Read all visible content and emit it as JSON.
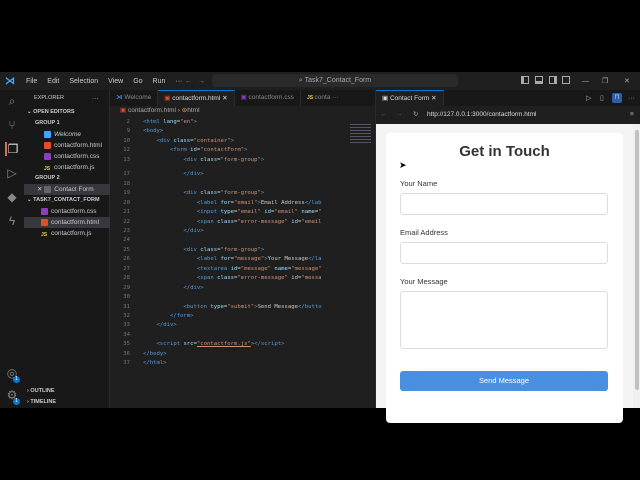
{
  "titlebar": {
    "menus": [
      "File",
      "Edit",
      "Selection",
      "View",
      "Go",
      "Run",
      "···"
    ],
    "command_center": "Task7_Contact_Form"
  },
  "sidebar": {
    "title": "EXPLORER",
    "open_editors": "OPEN EDITORS",
    "group1": "GROUP 1",
    "group1_items": [
      "Welcome",
      "contactform.html",
      "contactform.css",
      "contactform.js"
    ],
    "group2": "GROUP 2",
    "group2_items": [
      "Contact Form"
    ],
    "folder": "TASK7_CONTACT_FORM",
    "folder_items": [
      "contactform.css",
      "contactform.html",
      "contactform.js"
    ],
    "outline": "OUTLINE",
    "timeline": "TIMELINE",
    "badge": "1"
  },
  "editor": {
    "tabs": [
      "Welcome",
      "contactform.html",
      "contactform.css",
      "conta"
    ],
    "breadcrumb": [
      "contactform.html",
      "html"
    ],
    "lines": [
      [
        "2",
        [
          [
            "t",
            "<html "
          ],
          [
            "a",
            "lang"
          ],
          [
            "x",
            "="
          ],
          [
            "s",
            "\"en\""
          ],
          [
            "t",
            ">"
          ]
        ]
      ],
      [
        "9",
        [
          [
            "t",
            "<body>"
          ]
        ]
      ],
      [
        "10",
        [
          [
            "x",
            "    "
          ],
          [
            "t",
            "<div "
          ],
          [
            "a",
            "class"
          ],
          [
            "x",
            "="
          ],
          [
            "s",
            "\"container\""
          ],
          [
            "t",
            ">"
          ]
        ]
      ],
      [
        "12",
        [
          [
            "x",
            "        "
          ],
          [
            "t",
            "<form "
          ],
          [
            "a",
            "id"
          ],
          [
            "x",
            "="
          ],
          [
            "s",
            "\"contactForm\""
          ],
          [
            "t",
            ">"
          ]
        ]
      ],
      [
        "13",
        [
          [
            "x",
            "            "
          ],
          [
            "t",
            "<div "
          ],
          [
            "a",
            "class"
          ],
          [
            "x",
            "="
          ],
          [
            "s",
            "\"form-group\""
          ],
          [
            "t",
            ">"
          ]
        ]
      ],
      [
        "17",
        [
          [
            "x",
            "            "
          ],
          [
            "t",
            "</div>"
          ]
        ]
      ],
      [
        "18",
        []
      ],
      [
        "19",
        [
          [
            "x",
            "            "
          ],
          [
            "t",
            "<div "
          ],
          [
            "a",
            "class"
          ],
          [
            "x",
            "="
          ],
          [
            "s",
            "\"form-group\""
          ],
          [
            "t",
            ">"
          ]
        ]
      ],
      [
        "20",
        [
          [
            "x",
            "                "
          ],
          [
            "t",
            "<label "
          ],
          [
            "a",
            "for"
          ],
          [
            "x",
            "="
          ],
          [
            "s",
            "\"email\""
          ],
          [
            "t",
            ">"
          ],
          [
            "x",
            "Email Address"
          ],
          [
            "t",
            "</lab"
          ]
        ]
      ],
      [
        "21",
        [
          [
            "x",
            "                "
          ],
          [
            "t",
            "<input "
          ],
          [
            "a",
            "type"
          ],
          [
            "x",
            "="
          ],
          [
            "s",
            "\"email\" "
          ],
          [
            "a",
            "id"
          ],
          [
            "x",
            "="
          ],
          [
            "s",
            "\"email\" "
          ],
          [
            "a",
            "name"
          ],
          [
            "x",
            "="
          ],
          [
            "s",
            "\""
          ]
        ]
      ],
      [
        "22",
        [
          [
            "x",
            "                "
          ],
          [
            "t",
            "<span "
          ],
          [
            "a",
            "class"
          ],
          [
            "x",
            "="
          ],
          [
            "s",
            "\"error-message\" "
          ],
          [
            "a",
            "id"
          ],
          [
            "x",
            "="
          ],
          [
            "s",
            "\"email"
          ]
        ]
      ],
      [
        "23",
        [
          [
            "x",
            "            "
          ],
          [
            "t",
            "</div>"
          ]
        ]
      ],
      [
        "24",
        []
      ],
      [
        "25",
        [
          [
            "x",
            "            "
          ],
          [
            "t",
            "<div "
          ],
          [
            "a",
            "class"
          ],
          [
            "x",
            "="
          ],
          [
            "s",
            "\"form-group\""
          ],
          [
            "t",
            ">"
          ]
        ]
      ],
      [
        "26",
        [
          [
            "x",
            "                "
          ],
          [
            "t",
            "<label "
          ],
          [
            "a",
            "for"
          ],
          [
            "x",
            "="
          ],
          [
            "s",
            "\"message\""
          ],
          [
            "t",
            ">"
          ],
          [
            "x",
            "Your Message"
          ],
          [
            "t",
            "</la"
          ]
        ]
      ],
      [
        "27",
        [
          [
            "x",
            "                "
          ],
          [
            "t",
            "<textarea "
          ],
          [
            "a",
            "id"
          ],
          [
            "x",
            "="
          ],
          [
            "s",
            "\"message\" "
          ],
          [
            "a",
            "name"
          ],
          [
            "x",
            "="
          ],
          [
            "s",
            "\"message\""
          ]
        ]
      ],
      [
        "28",
        [
          [
            "x",
            "                "
          ],
          [
            "t",
            "<span "
          ],
          [
            "a",
            "class"
          ],
          [
            "x",
            "="
          ],
          [
            "s",
            "\"error-message\" "
          ],
          [
            "a",
            "id"
          ],
          [
            "x",
            "="
          ],
          [
            "s",
            "\"messa"
          ]
        ]
      ],
      [
        "29",
        [
          [
            "x",
            "            "
          ],
          [
            "t",
            "</div>"
          ]
        ]
      ],
      [
        "30",
        []
      ],
      [
        "31",
        [
          [
            "x",
            "            "
          ],
          [
            "t",
            "<button "
          ],
          [
            "a",
            "type"
          ],
          [
            "x",
            "="
          ],
          [
            "s",
            "\"submit\""
          ],
          [
            "t",
            ">"
          ],
          [
            "x",
            "Send Message"
          ],
          [
            "t",
            "</butto"
          ]
        ]
      ],
      [
        "32",
        [
          [
            "x",
            "        "
          ],
          [
            "t",
            "</form>"
          ]
        ]
      ],
      [
        "33",
        [
          [
            "x",
            "    "
          ],
          [
            "t",
            "</div>"
          ]
        ]
      ],
      [
        "34",
        []
      ],
      [
        "35",
        [
          [
            "x",
            "    "
          ],
          [
            "t",
            "<script "
          ],
          [
            "a",
            "src"
          ],
          [
            "x",
            "="
          ],
          [
            "s",
            "\"contactform.js\""
          ],
          [
            "t",
            "></script>"
          ]
        ]
      ],
      [
        "36",
        [
          [
            "t",
            "</body>"
          ]
        ]
      ],
      [
        "37",
        [
          [
            "t",
            "</html>"
          ]
        ]
      ]
    ]
  },
  "browser": {
    "tab": "Contact Form",
    "url": "http://127.0.0.1:3000/contactform.html",
    "form": {
      "title": "Get in Touch",
      "name_label": "Your Name",
      "email_label": "Email Address",
      "message_label": "Your Message",
      "submit": "Send Message"
    }
  },
  "colors": {
    "accent": "#0078d4",
    "button": "#4a90e2"
  }
}
